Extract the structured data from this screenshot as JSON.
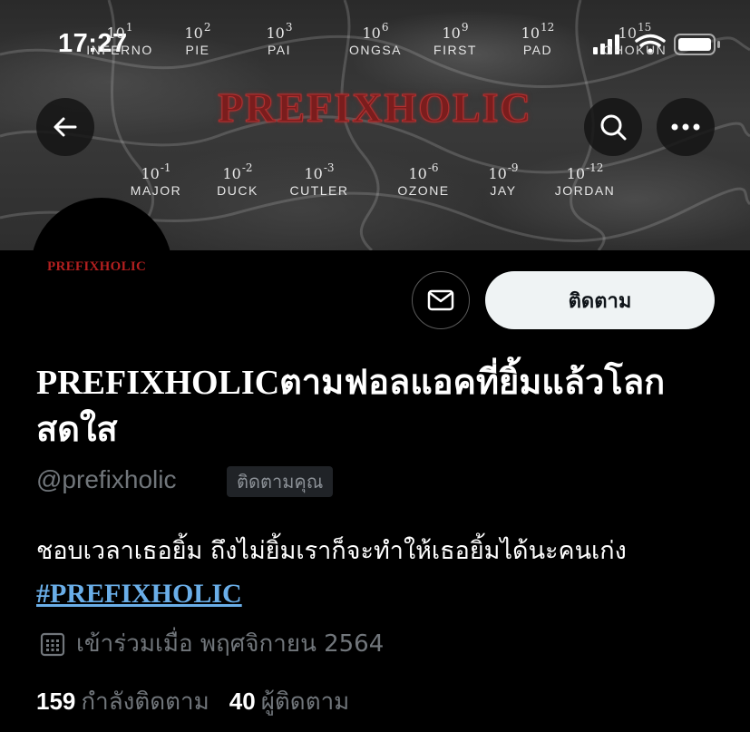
{
  "status_bar": {
    "time": "17:27"
  },
  "banner": {
    "title": "PREFIXHOLIC",
    "top_row": [
      {
        "base": "10",
        "exp": "1",
        "name": "INFERNO"
      },
      {
        "base": "10",
        "exp": "2",
        "name": "PIE"
      },
      {
        "base": "10",
        "exp": "3",
        "name": "PAI"
      },
      {
        "base": "10",
        "exp": "6",
        "name": "ONGSA"
      },
      {
        "base": "10",
        "exp": "9",
        "name": "FIRST"
      },
      {
        "base": "10",
        "exp": "12",
        "name": "PAD"
      },
      {
        "base": "10",
        "exp": "15",
        "name": "OHOKUN"
      }
    ],
    "bottom_row": [
      {
        "base": "10",
        "exp": "-1",
        "name": "MAJOR"
      },
      {
        "base": "10",
        "exp": "-2",
        "name": "DUCK"
      },
      {
        "base": "10",
        "exp": "-3",
        "name": "CUTLER"
      },
      {
        "base": "10",
        "exp": "-6",
        "name": "OZONE"
      },
      {
        "base": "10",
        "exp": "-9",
        "name": "JAY"
      },
      {
        "base": "10",
        "exp": "-12",
        "name": "JORDAN"
      }
    ]
  },
  "profile": {
    "avatar_text": "PREFIXHOLIC",
    "follow_label": "ติดตาม",
    "display_name": "PREFIXHOLICตามฟอลแอคที่ยิ้มแล้วโลกสดใส",
    "handle": "@prefixholic",
    "follows_you": "ติดตามคุณ",
    "bio_text": "ชอบเวลาเธอยิ้ม ถึงไม่ยิ้มเราก็จะทำให้เธอยิ้มได้นะคนเก่ง ",
    "bio_hashtag": "#PREFIXHOLIC",
    "joined": "เข้าร่วมเมื่อ พฤศจิกายน 2564",
    "following_count": "159",
    "following_label": "กำลังติดตาม",
    "followers_count": "40",
    "followers_label": "ผู้ติดตาม"
  },
  "icons": {
    "back": "arrow-left-icon",
    "search": "search-icon",
    "more": "more-icon",
    "mail": "mail-icon",
    "calendar": "calendar-icon"
  },
  "colors": {
    "follow_button_bg": "#eff3f4",
    "hashtag": "#6aaee8",
    "muted_text": "#71767b",
    "title_red": "#7a1d1d"
  }
}
